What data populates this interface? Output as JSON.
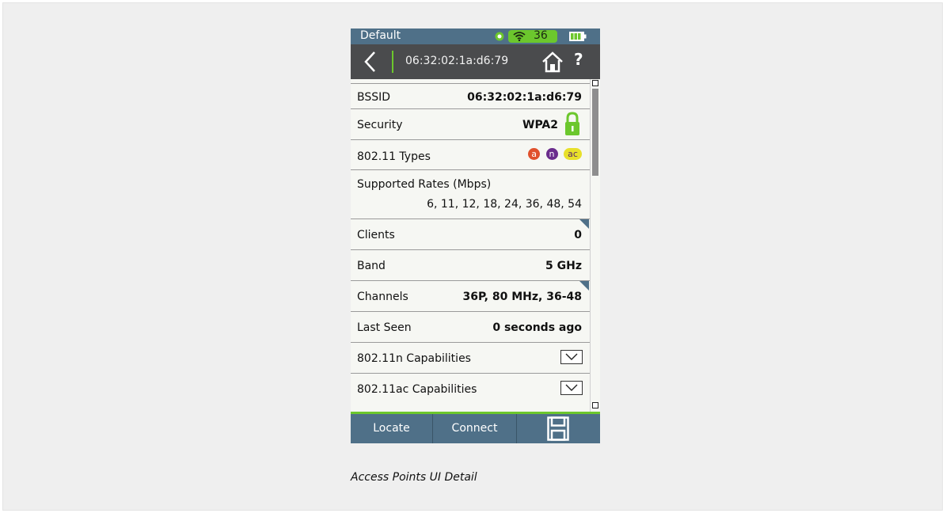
{
  "status": {
    "profile": "Default",
    "signal_channel": "36"
  },
  "nav": {
    "title": "06:32:02:1a:d6:79",
    "help_label": "?"
  },
  "rows": {
    "bssid": {
      "label": "BSSID",
      "value": "06:32:02:1a:d6:79"
    },
    "security": {
      "label": "Security",
      "value": "WPA2"
    },
    "types": {
      "label": "802.11 Types",
      "badges": [
        "a",
        "n",
        "ac"
      ]
    },
    "rates": {
      "label": "Supported Rates (Mbps)",
      "value": "6, 11, 12, 18, 24, 36, 48, 54"
    },
    "clients": {
      "label": "Clients",
      "value": "0"
    },
    "band": {
      "label": "Band",
      "value": "5 GHz"
    },
    "channels": {
      "label": "Channels",
      "value": "36P, 80 MHz, 36-48"
    },
    "last_seen": {
      "label": "Last Seen",
      "value": "0 seconds ago"
    },
    "n_caps": {
      "label": "802.11n Capabilities"
    },
    "ac_caps": {
      "label": "802.11ac Capabilities"
    }
  },
  "toolbar": {
    "locate": "Locate",
    "connect": "Connect"
  },
  "caption": "Access Points UI Detail",
  "colors": {
    "header_blue": "#4f7088",
    "nav_dark": "#4a4b4d",
    "accent_green": "#6cc72d",
    "badge_a": "#e0512c",
    "badge_n": "#6a2c8c",
    "badge_ac": "#e8e02a"
  },
  "icons": [
    "gps-icon",
    "wifi-icon",
    "battery-icon",
    "back-arrow-icon",
    "home-icon",
    "lock-icon",
    "chevron-down-icon",
    "save-icon"
  ]
}
